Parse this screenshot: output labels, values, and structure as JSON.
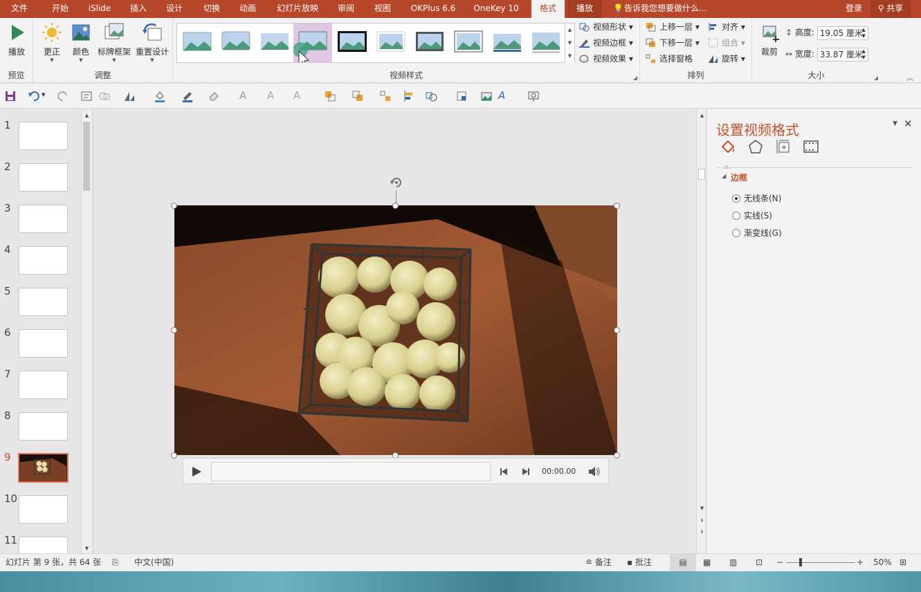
{
  "tabs": [
    {
      "label": "文件",
      "state": "normal"
    },
    {
      "label": "开始",
      "state": "normal"
    },
    {
      "label": "iSlide",
      "state": "normal"
    },
    {
      "label": "插入",
      "state": "normal"
    },
    {
      "label": "设计",
      "state": "normal"
    },
    {
      "label": "切换",
      "state": "normal"
    },
    {
      "label": "动画",
      "state": "normal"
    },
    {
      "label": "幻灯片放映",
      "state": "normal"
    },
    {
      "label": "审阅",
      "state": "normal"
    },
    {
      "label": "视图",
      "state": "normal"
    },
    {
      "label": "OKPlus 6.6",
      "state": "normal"
    },
    {
      "label": "OneKey 10",
      "state": "normal"
    },
    {
      "label": "格式",
      "state": "active"
    },
    {
      "label": "播放",
      "state": "context"
    }
  ],
  "tellme": "告诉我您想要做什么...",
  "login": "登录",
  "share": "共享",
  "ribbon": {
    "preview": {
      "play": "播放",
      "group": "预览"
    },
    "adjust": {
      "correct": "更正",
      "color": "颜色",
      "poster": "标牌框架",
      "reset": "重置设计",
      "group": "调整"
    },
    "styles": {
      "group": "视频样式",
      "shape": "视频形状",
      "border": "视频边框",
      "effects": "视频效果"
    },
    "arrange": {
      "forward": "上移一层",
      "backward": "下移一层",
      "selection": "选择窗格",
      "align": "对齐",
      "group_btn": "组合",
      "rotate": "旋转",
      "group": "排列"
    },
    "size": {
      "crop": "裁剪",
      "height_label": "高度:",
      "height_value": "19.05 厘米",
      "width_label": "宽度:",
      "width_value": "33.87 厘米",
      "group": "大小"
    }
  },
  "slides": [
    "1",
    "2",
    "3",
    "4",
    "5",
    "6",
    "7",
    "8",
    "9",
    "10",
    "11"
  ],
  "selected_slide": "9",
  "player": {
    "time": "00:00.00"
  },
  "format_pane": {
    "title": "设置视频格式",
    "section": "边框",
    "options": [
      "无线条(N)",
      "实线(S)",
      "渐变线(G)"
    ],
    "selected_option": "无线条(N)"
  },
  "status": {
    "slide_info": "幻灯片 第 9 张，共 64 张",
    "language": "中文(中国)",
    "notes": "备注",
    "comments": "批注",
    "zoom": "50%"
  },
  "colors": {
    "accent": "#b7472a",
    "pane_title": "#c5502c",
    "hover_style": "#dec8e3"
  }
}
